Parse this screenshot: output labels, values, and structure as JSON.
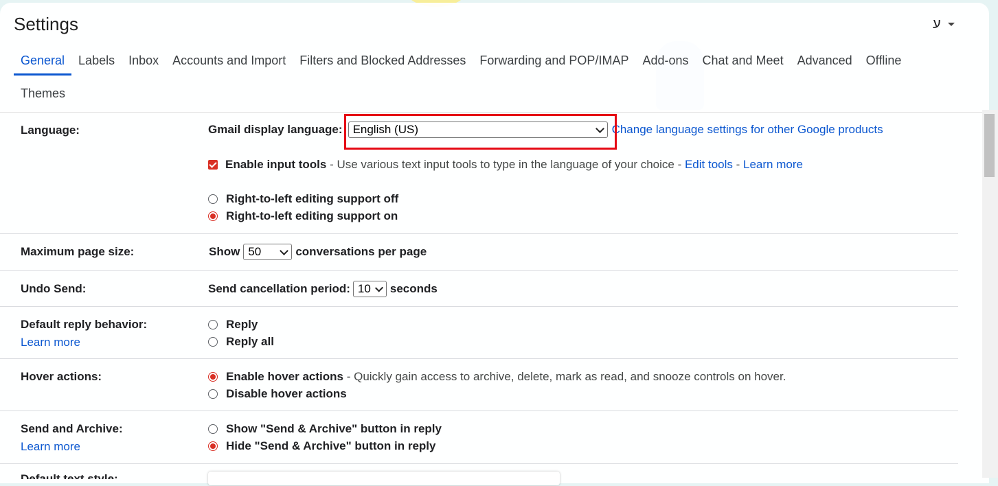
{
  "header": {
    "title": "Settings",
    "language_toggle": "ע"
  },
  "tabs": [
    {
      "label": "General"
    },
    {
      "label": "Labels"
    },
    {
      "label": "Inbox"
    },
    {
      "label": "Accounts and Import"
    },
    {
      "label": "Filters and Blocked Addresses"
    },
    {
      "label": "Forwarding and POP/IMAP"
    },
    {
      "label": "Add-ons"
    },
    {
      "label": "Chat and Meet"
    },
    {
      "label": "Advanced"
    },
    {
      "label": "Offline"
    },
    {
      "label": "Themes"
    }
  ],
  "language": {
    "label": "Language:",
    "display_language_label": "Gmail display language:",
    "display_language_value": "English (US)",
    "change_link": "Change language settings for other Google products",
    "input_tools_label": "Enable input tools",
    "input_tools_desc": " - Use various text input tools to type in the language of your choice - ",
    "edit_tools": "Edit tools",
    "separator": " - ",
    "learn_more": "Learn more",
    "rtl_off": "Right-to-left editing support off",
    "rtl_on": "Right-to-left editing support on"
  },
  "page_size": {
    "label": "Maximum page size:",
    "show": "Show",
    "value": "50",
    "suffix": "conversations per page"
  },
  "undo_send": {
    "label": "Undo Send:",
    "prefix": "Send cancellation period:",
    "value": "10",
    "suffix": "seconds"
  },
  "reply_behavior": {
    "label": "Default reply behavior:",
    "learn_more": "Learn more",
    "reply": "Reply",
    "reply_all": "Reply all"
  },
  "hover_actions": {
    "label": "Hover actions:",
    "enable": "Enable hover actions",
    "enable_desc": " - Quickly gain access to archive, delete, mark as read, and snooze controls on hover.",
    "disable": "Disable hover actions"
  },
  "send_archive": {
    "label": "Send and Archive:",
    "learn_more": "Learn more",
    "show": "Show \"Send & Archive\" button in reply",
    "hide": "Hide \"Send & Archive\" button in reply"
  },
  "next_row": {
    "label": "Default text style:"
  },
  "colors": {
    "accent": "#0b57d0",
    "selected": "#d93025",
    "highlight": "#e50914"
  }
}
